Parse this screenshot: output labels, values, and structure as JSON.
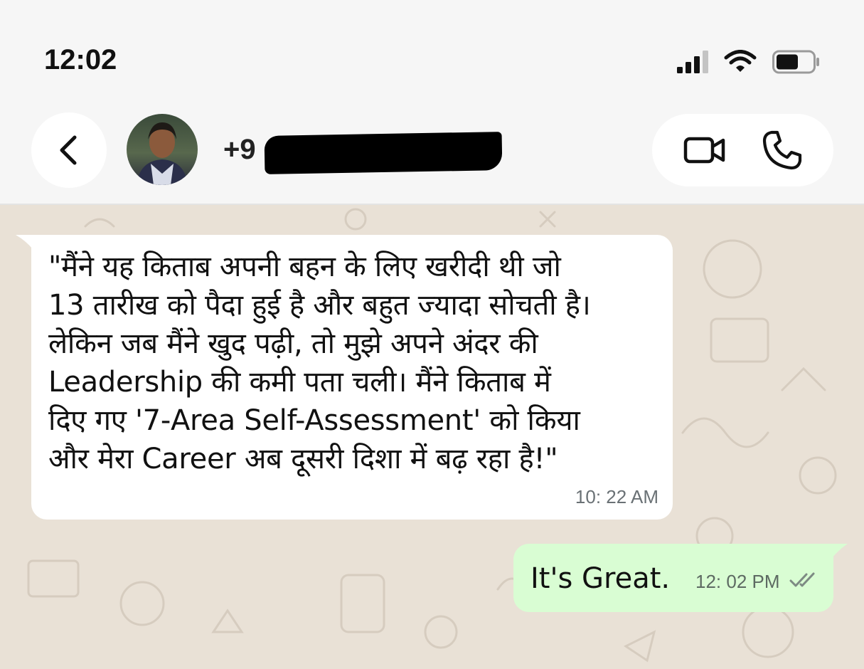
{
  "status_bar": {
    "time": "12:02",
    "icons": [
      "signal-icon",
      "wifi-icon",
      "battery-icon"
    ]
  },
  "header": {
    "contact_name": "+9",
    "contact_name_redacted": true,
    "icons": [
      "back-icon",
      "video-call-icon",
      "phone-icon"
    ]
  },
  "messages": [
    {
      "direction": "incoming",
      "text": "\"मैंने यह किताब अपनी बहन के लिए खरीदी थी जो\n13 तारीख को पैदा हुई है और बहुत ज्यादा सोचती है।\nलेकिन जब मैंने खुद पढ़ी, तो मुझे अपने अंदर की\nLeadership की कमी पता चली। मैंने किताब में\nदिए गए '7-Area Self-Assessment' को किया\nऔर मेरा Career अब दूसरी दिशा में बढ़ रहा है!\"",
      "time": "10: 22 AM"
    },
    {
      "direction": "outgoing",
      "text": "It's Great.",
      "time": "12: 02 PM",
      "status": "read"
    }
  ],
  "colors": {
    "chat_background": "#e9e1d6",
    "incoming_bubble": "#ffffff",
    "outgoing_bubble": "#d9fdd3",
    "header_background": "#f6f6f6"
  }
}
